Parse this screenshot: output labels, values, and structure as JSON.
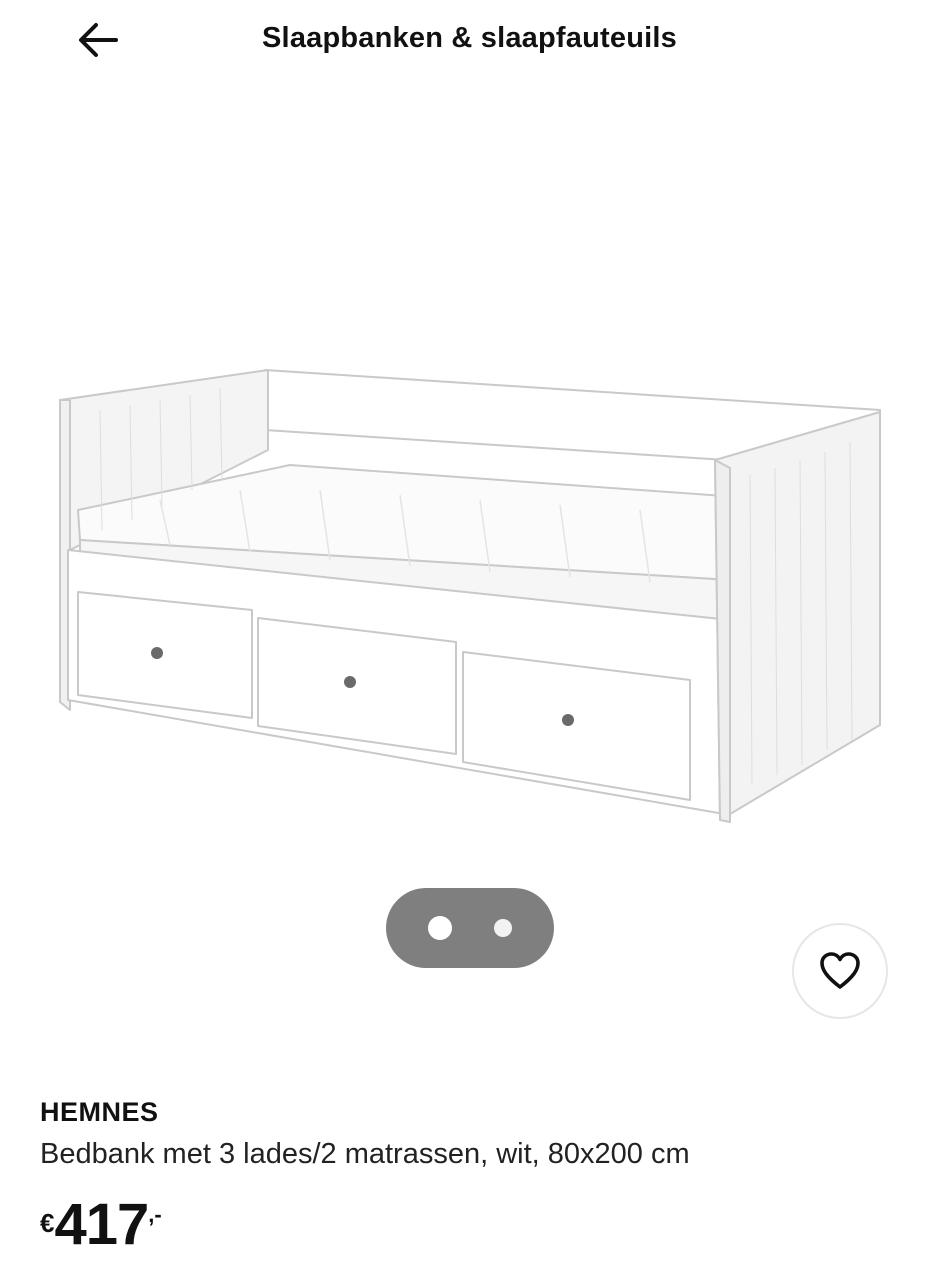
{
  "header": {
    "title": "Slaapbanken & slaapfauteuils",
    "back_icon": "arrow-left-icon"
  },
  "gallery": {
    "image_alt": "HEMNES bedbank wit",
    "slides": 2,
    "active_slide": 1
  },
  "favorite": {
    "icon": "heart-outline-icon"
  },
  "product": {
    "name": "HEMNES",
    "description": "Bedbank met 3 lades/2 matrassen, wit, 80x200 cm",
    "price": {
      "currency": "€",
      "amount": "417",
      "decimals": ",-"
    }
  },
  "colors": {
    "text": "#111111",
    "dots_bg": "#7f7f7f"
  }
}
